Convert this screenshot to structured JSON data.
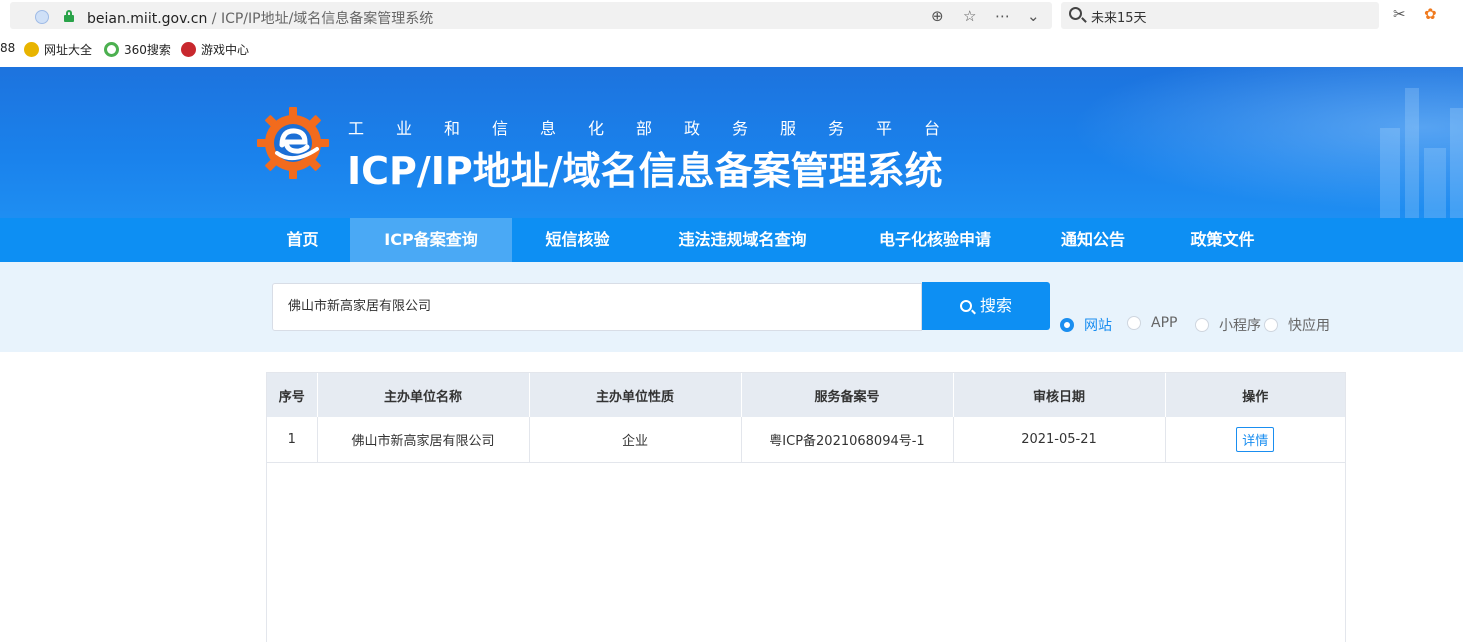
{
  "browser": {
    "url_domain": "beian.miit.gov.cn",
    "url_path": " / ICP/IP地址/域名信息备案管理系统",
    "search_text": "未来15天",
    "bookmarks": [
      {
        "label": "88",
        "icon": "truncated-bookmark",
        "color": ""
      },
      {
        "label": "网址大全",
        "icon": "yellow-globe-icon",
        "color": "#e8b400"
      },
      {
        "label": "360搜索",
        "icon": "360-search-icon",
        "color": "#4cb050"
      },
      {
        "label": "游戏中心",
        "icon": "game-center-icon",
        "color": "#c8282e"
      }
    ]
  },
  "header": {
    "subtitle": "工业和信息化部政务服务平台",
    "title": "ICP/IP地址/域名信息备案管理系统"
  },
  "nav": {
    "items": [
      "首页",
      "ICP备案查询",
      "短信核验",
      "违法违规域名查询",
      "电子化核验申请",
      "通知公告",
      "政策文件"
    ],
    "active_index": 1
  },
  "search": {
    "value": "佛山市新高家居有限公司",
    "button_label": "搜索",
    "types": [
      "网站",
      "APP",
      "小程序",
      "快应用"
    ],
    "selected_type": "网站"
  },
  "results": {
    "columns": [
      "序号",
      "主办单位名称",
      "主办单位性质",
      "服务备案号",
      "审核日期",
      "操作"
    ],
    "rows": [
      {
        "index": "1",
        "name": "佛山市新高家居有限公司",
        "nature": "企业",
        "license": "粤ICP备2021068094号-1",
        "date": "2021-05-21",
        "action": "详情"
      }
    ]
  },
  "colors": {
    "primary": "#0d8ff3",
    "header_bg": "#1a82ec",
    "search_bg": "#e8f3fc",
    "table_header_bg": "#e6ebf2"
  }
}
